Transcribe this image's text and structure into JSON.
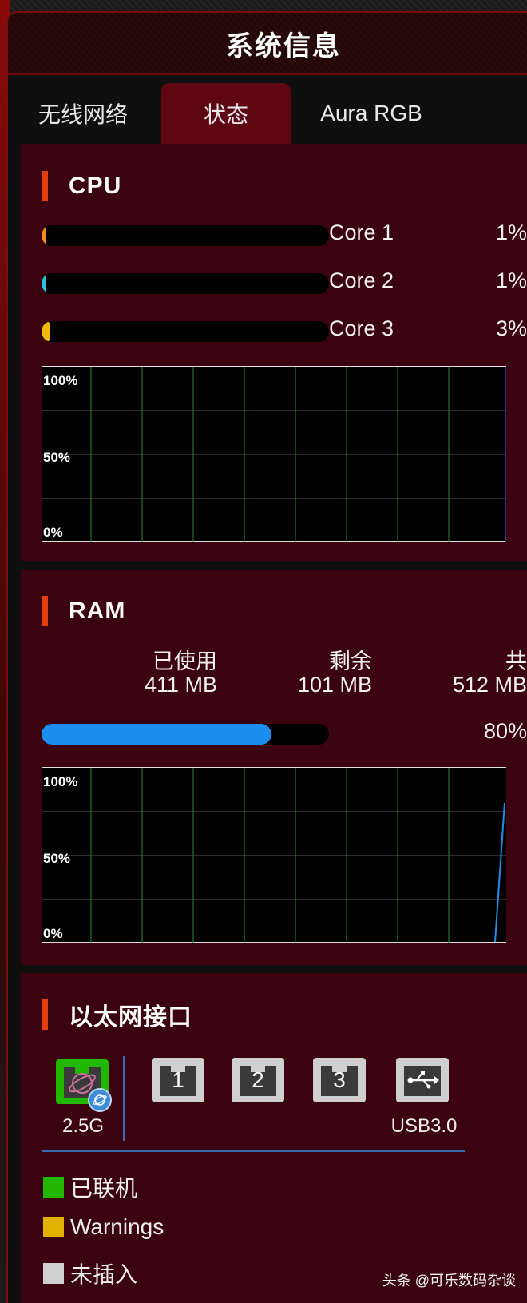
{
  "title": "系统信息",
  "tabs": [
    "无线网络",
    "状态",
    "Aura RGB"
  ],
  "cpu": {
    "title": "CPU",
    "cores": [
      {
        "label": "Core 1",
        "value": "1%",
        "percent": 1,
        "color": "#f08a1e"
      },
      {
        "label": "Core 2",
        "value": "1%",
        "percent": 1,
        "color": "#2ec0d8"
      },
      {
        "label": "Core 3",
        "value": "3%",
        "percent": 3,
        "color": "#f0b90c"
      }
    ],
    "graph_labels": [
      "100%",
      "50%",
      "0%"
    ]
  },
  "ram": {
    "title": "RAM",
    "used_label": "已使用",
    "used_value": "411 MB",
    "free_label": "剩余",
    "free_value": "101 MB",
    "total_label": "共",
    "total_value": "512 MB",
    "usage_value": "80%",
    "usage_percent": 80,
    "bar_color": "#1b8ef0",
    "graph_labels": [
      "100%",
      "50%",
      "0%"
    ]
  },
  "ethernet": {
    "title": "以太网接口",
    "wan_label": "2.5G",
    "ports": [
      "1",
      "2",
      "3"
    ],
    "usb_label": "USB3.0",
    "legend": [
      {
        "label": "已联机",
        "color": "#22b800"
      },
      {
        "label": "Warnings",
        "color": "#e2b200"
      },
      {
        "label": "未插入",
        "color": "#cfcfcf"
      }
    ]
  },
  "watermark": "头条 @可乐数码杂谈"
}
